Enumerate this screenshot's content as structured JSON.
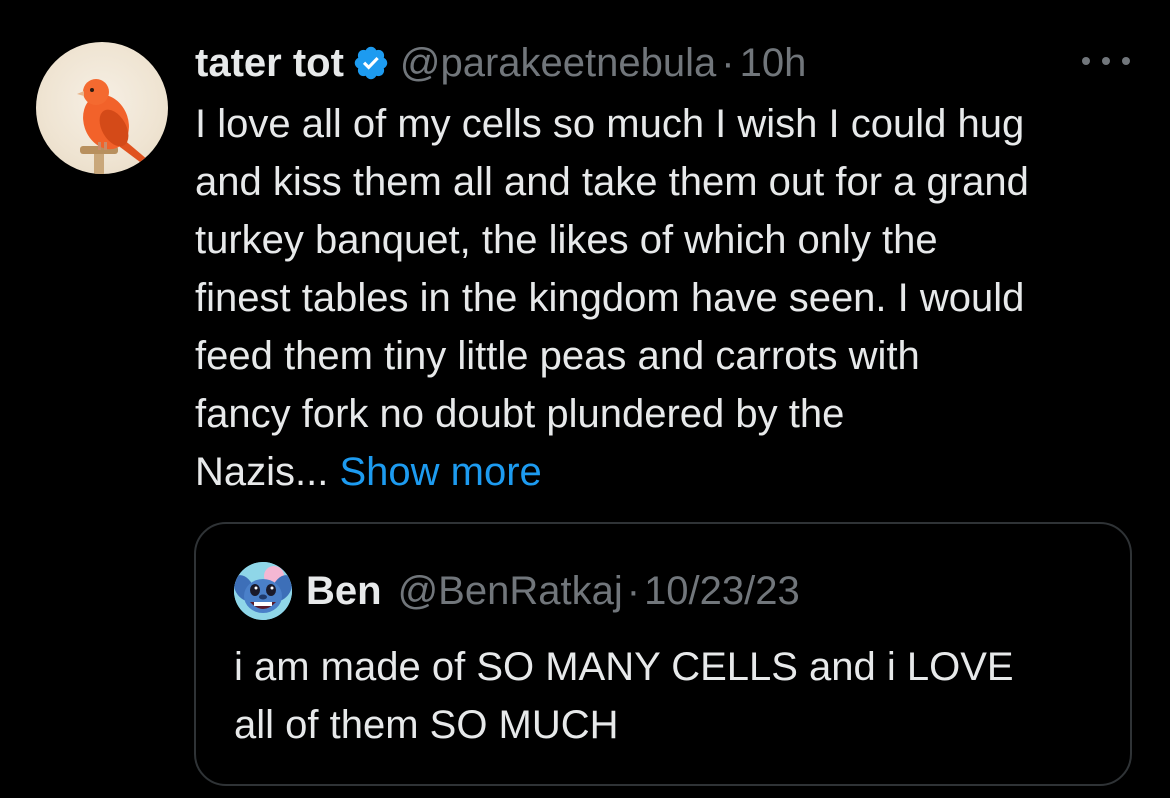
{
  "tweet": {
    "author": {
      "display_name": "tater tot",
      "handle": "@parakeetnebula",
      "verified": true,
      "avatar_icon": "red-canary-avatar"
    },
    "separator": "·",
    "time": "10h",
    "more_icon": "more-horizontal-icon",
    "text": "I love all of my cells so much I wish I could hug\nand kiss them all and take them out for a grand\nturkey banquet, the likes of which only the\nfinest tables in the kingdom have seen. I would\nfeed them tiny little peas and carrots with\nfancy fork no doubt plundered by the\nNazis... ",
    "show_more_label": "Show more"
  },
  "quote": {
    "author": {
      "display_name": "Ben",
      "handle": "@BenRatkaj",
      "avatar_icon": "stitch-avatar"
    },
    "separator": "·",
    "date": "10/23/23",
    "text": "i am made of SO MANY CELLS and i LOVE\nall of them SO MUCH"
  },
  "colors": {
    "background": "#000000",
    "primary_text": "#e7e9ea",
    "secondary_text": "#71767b",
    "link": "#1d9bf0",
    "verified_badge": "#1d9bf0",
    "border": "#2f3336"
  }
}
